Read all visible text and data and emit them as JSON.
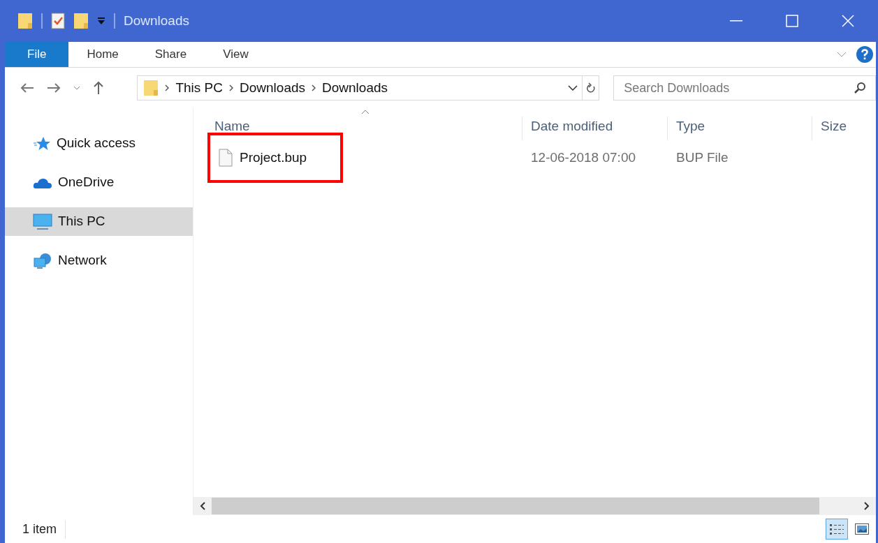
{
  "window": {
    "title": "Downloads"
  },
  "ribbon_tabs": [
    {
      "label": "File",
      "selected": true
    },
    {
      "label": "Home",
      "selected": false
    },
    {
      "label": "Share",
      "selected": false
    },
    {
      "label": "View",
      "selected": false
    }
  ],
  "address": {
    "crumbs": [
      "This PC",
      "Downloads",
      "Downloads"
    ]
  },
  "search": {
    "placeholder": "Search Downloads"
  },
  "sidebar": {
    "items": [
      {
        "label": "Quick access",
        "kind": "star",
        "selected": false
      },
      {
        "label": "OneDrive",
        "kind": "cloud",
        "selected": false
      },
      {
        "label": "This PC",
        "kind": "pc",
        "selected": true
      },
      {
        "label": "Network",
        "kind": "network",
        "selected": false
      }
    ]
  },
  "table": {
    "columns": [
      "Name",
      "Date modified",
      "Type",
      "Size"
    ],
    "rows": [
      {
        "name": "Project.bup",
        "date": "12-06-2018 07:00",
        "type": "BUP File",
        "highlighted": true
      }
    ]
  },
  "status_bar": {
    "text": "1 item"
  },
  "view_buttons": [
    {
      "kind": "details",
      "selected": true
    },
    {
      "kind": "large-icons",
      "selected": false
    }
  ]
}
